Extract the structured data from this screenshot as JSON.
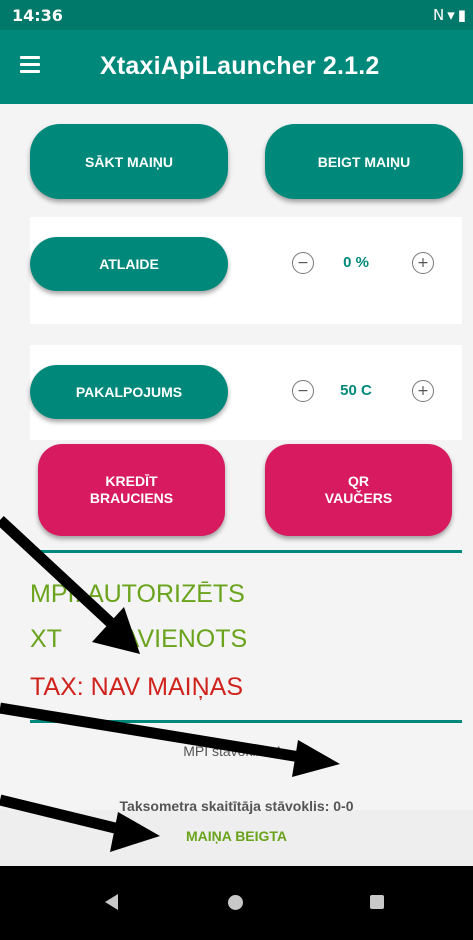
{
  "status_bar": {
    "time": "14:36",
    "icons": [
      "nfc-icon",
      "wifi-icon",
      "battery-icon"
    ]
  },
  "app_bar": {
    "title": "XtaxiApiLauncher 2.1.2"
  },
  "shift": {
    "start_label": "SĀKT MAIŅU",
    "end_label": "BEIGT MAIŅU"
  },
  "discount": {
    "label": "ATLAIDE",
    "minus": "−",
    "value": "0 %",
    "plus": "+"
  },
  "service": {
    "label": "PAKALPOJUMS",
    "minus": "−",
    "value": "50 C",
    "plus": "+"
  },
  "pink_buttons": {
    "credit_line1": "KREDĪT",
    "credit_line2": "BRAUCIENS",
    "qr_line1": "QR",
    "qr_line2": "VAUČERS"
  },
  "status": {
    "mpi": "MPI: AUTORIZĒTS",
    "xt_prefix": "XT",
    "xt_suffix": "SAVIENOTS",
    "tax": "TAX: NAV MAIŅAS"
  },
  "info": {
    "mpi_state": "MPI stāvoklis: 4 -",
    "taximeter_state": "Taksometra skaitītāja stāvoklis: 0-0",
    "shift_state": "MAIŅA BEIGTA"
  },
  "colors": {
    "primary": "#00897b",
    "status_bar": "#00796b",
    "pink": "#d81b60",
    "ok_green": "#6aa31c",
    "error_red": "#d0231d"
  }
}
